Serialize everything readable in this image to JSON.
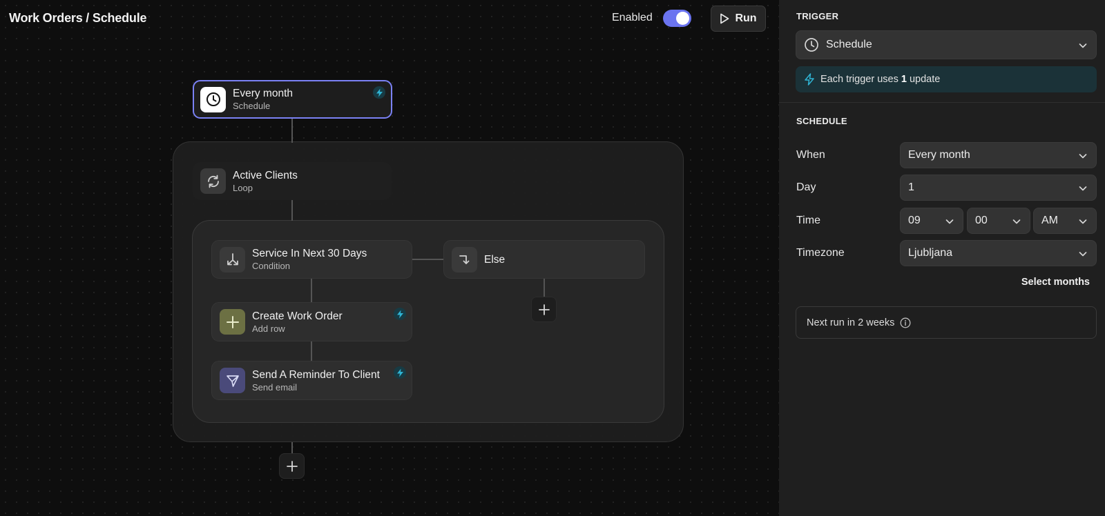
{
  "header": {
    "breadcrumb": "Work Orders / Schedule",
    "enabled_label": "Enabled",
    "enabled": true,
    "run_label": "Run"
  },
  "flow": {
    "trigger": {
      "title": "Every month",
      "subtitle": "Schedule",
      "icon": "clock-icon"
    },
    "loop": {
      "title": "Active Clients",
      "subtitle": "Loop",
      "icon": "loop-icon"
    },
    "condition": {
      "title": "Service In Next 30 Days",
      "subtitle": "Condition",
      "icon": "branch-icon"
    },
    "else": {
      "title": "Else",
      "icon": "else-arrow-icon"
    },
    "create": {
      "title": "Create Work Order",
      "subtitle": "Add row",
      "icon": "plus-icon"
    },
    "reminder": {
      "title": "Send A Reminder To Client",
      "subtitle": "Send email",
      "icon": "send-icon"
    }
  },
  "panel": {
    "trigger_title": "TRIGGER",
    "trigger_value": "Schedule",
    "info_prefix": "Each trigger uses",
    "info_count": "1",
    "info_suffix": "update",
    "schedule_title": "SCHEDULE",
    "when_label": "When",
    "when_value": "Every month",
    "day_label": "Day",
    "day_value": "1",
    "time_label": "Time",
    "time_hour": "09",
    "time_minute": "00",
    "time_period": "AM",
    "timezone_label": "Timezone",
    "timezone_value": "Ljubljana",
    "select_months": "Select months",
    "next_run": "Next run in 2 weeks"
  },
  "colors": {
    "accent": "#7b82f5",
    "bolt": "#2fb4d4",
    "info_bg": "#1b3238"
  }
}
